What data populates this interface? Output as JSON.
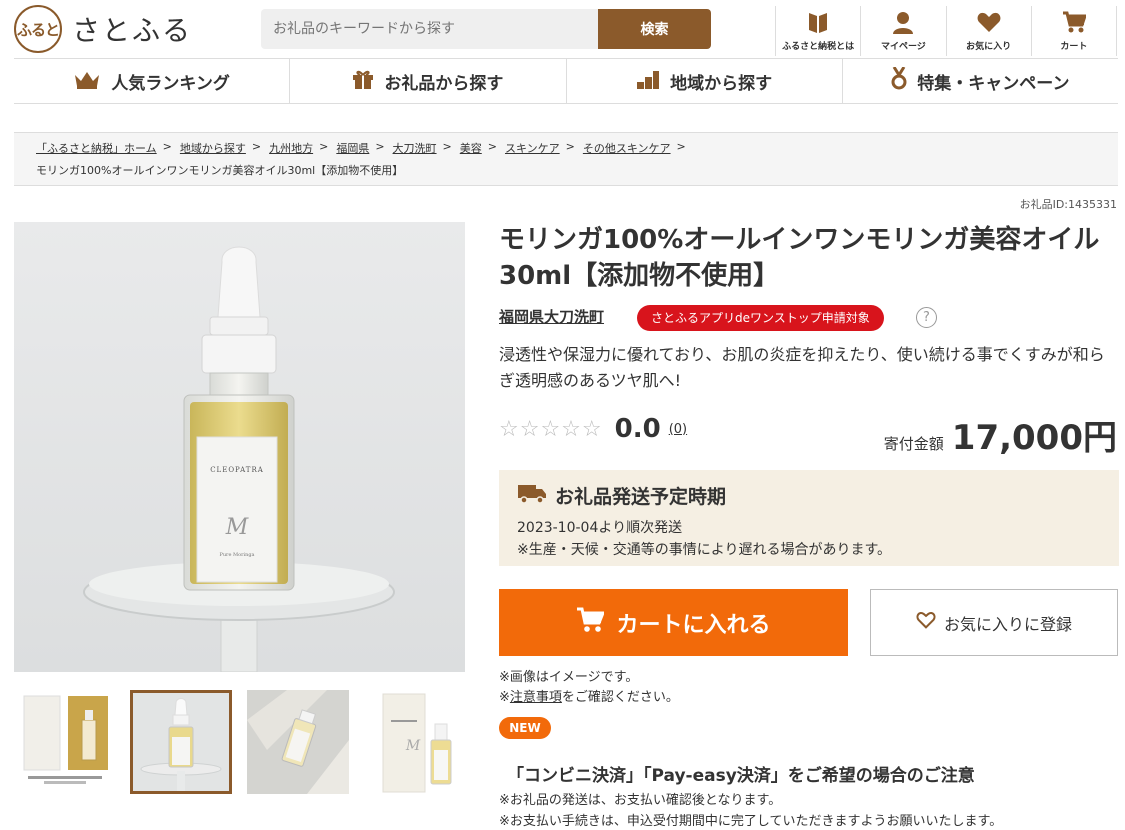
{
  "header": {
    "logo_mark": "ふると",
    "logo_text": "さとふる",
    "search_placeholder": "お礼品のキーワードから探す",
    "search_button": "検索",
    "utils": [
      {
        "label": "ふるさと納税とは",
        "icon": "book-icon"
      },
      {
        "label": "マイページ",
        "icon": "user-icon"
      },
      {
        "label": "お気に入り",
        "icon": "heart-icon"
      },
      {
        "label": "カート",
        "icon": "cart-icon"
      }
    ]
  },
  "gnav": [
    {
      "label": "人気ランキング",
      "icon": "crown-icon"
    },
    {
      "label": "お礼品から探す",
      "icon": "gift-icon"
    },
    {
      "label": "地域から探す",
      "icon": "region-icon"
    },
    {
      "label": "特集・キャンペーン",
      "icon": "medal-icon"
    }
  ],
  "breadcrumb": {
    "links": [
      "「ふるさと納税」ホーム",
      "地域から探す",
      "九州地方",
      "福岡県",
      "大刀洗町",
      "美容",
      "スキンケア",
      "その他スキンケア"
    ],
    "current": "モリンガ100%オールインワンモリンガ美容オイル30ml【添加物不使用】"
  },
  "item_id": "お礼品ID:1435331",
  "product": {
    "title": "モリンガ100%オールインワンモリンガ美容オイル30ml【添加物不使用】",
    "municipality": "福岡県大刀洗町",
    "app_badge": "さとふるアプリdeワンストップ申請対象",
    "help": "?",
    "catch": "浸透性や保湿力に優れており、お肌の炎症を抑えたり、使い続ける事でくすみが和らぎ透明感のあるツヤ肌へ!",
    "stars": "☆☆☆☆☆",
    "score": "0.0",
    "reviews": "(0)",
    "price_label": "寄付金額",
    "price": "17,000円",
    "image_label_brand": "CLEOPATRA",
    "image_label_sub": "Pure Moringa"
  },
  "shipping": {
    "title": "お礼品発送予定時期",
    "date": "2023-10-04より順次発送",
    "note": "※生産・天候・交通等の事情により遅れる場合があります。"
  },
  "actions": {
    "cart": "カートに入れる",
    "favorite": "お気に入りに登録"
  },
  "notes": {
    "line1": "※画像はイメージです。",
    "prefix": "※",
    "link": "注意事項",
    "suffix": "をご確認ください。"
  },
  "new_badge": "NEW",
  "convenience": {
    "title": "「コンビニ決済」「Pay-easy決済」をご希望の場合のご注意",
    "line1": "※お礼品の発送は、お支払い確認後となります。",
    "line2": "※お支払い手続きは、申込受付期間中に完了していただきますようお願いいたします。"
  },
  "colors": {
    "brand": "#8b5a2b",
    "accent": "#f26a0a",
    "badge_red": "#d8141c",
    "ship_bg": "#f5efe3"
  }
}
